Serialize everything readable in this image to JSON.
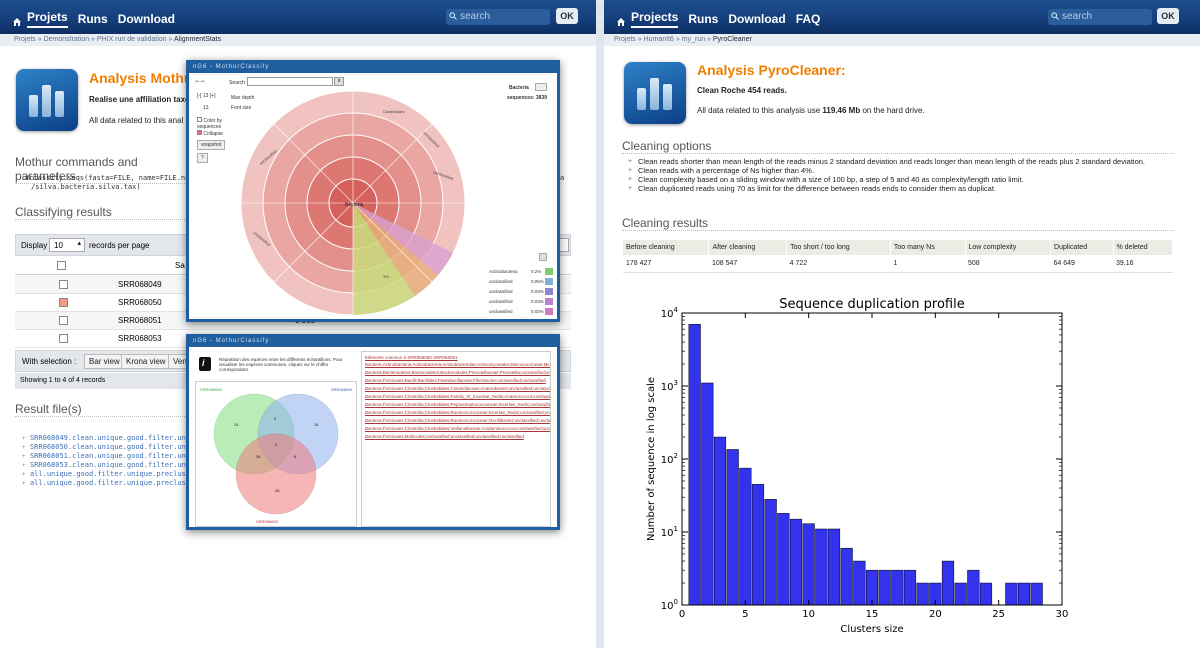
{
  "left": {
    "nav": {
      "projects": "Projets",
      "runs": "Runs",
      "download": "Download"
    },
    "search_placeholder": "search",
    "ok": "OK",
    "breadcrumb": [
      "Projets",
      "Demonstration",
      "PHIX run de validation",
      "AlignmentStats"
    ],
    "title": "Analysis MothurC",
    "subtitle": "Realise une affiliation taxo",
    "disk_text": "All data related to this anal",
    "commands_title": "Mothur commands and parameters",
    "command_line1": "#classify.seqs(fasta=FILE, name=FILE.names,",
    "command_line1_tail": "a",
    "command_line2": "/silva.bacteria.silva.tax)",
    "classifying_title": "Classifying results",
    "display_label": "Display",
    "display_value": "10",
    "records_label": "records per page",
    "col_sample": "Sa",
    "rows": [
      "SRR068049",
      "SRR068050",
      "SRR068051",
      "SRR068053"
    ],
    "row_side_value": "3 508",
    "with_selection": "With selection :",
    "bar_view": "Bar view",
    "krona_view": "Krona view",
    "ven_btn": "Ven",
    "showing": "Showing 1 to 4 of 4 records",
    "result_files_title": "Result file(s)",
    "files": [
      "SRR068049.clean.unique.good.filter.unique",
      "SRR068050.clean.unique.good.filter.unique",
      "SRR068051.clean.unique.good.filter.unique",
      "SRR068053.clean.unique.good.filter.unique",
      "all.unique.good.filter.unique.precluster.pi",
      "all.unique.good.filter.unique.precluster.pl"
    ],
    "krona": {
      "title": "nG6 - MothurClassify",
      "search_label": "Search:",
      "max_depth": "Max depth",
      "font_size": "Font size",
      "depth_val": "13",
      "color_by": "Color by sequences",
      "collapse": "Collapse",
      "snapshot": "snapshot",
      "root": "Bacteria",
      "header_right": "Bacteria",
      "sequences": "sequences: 3839",
      "legend": [
        {
          "name": "Actinobacteria",
          "pct": "0.2%",
          "color": "#7ecb6f"
        },
        {
          "name": "unclassified",
          "pct": "0.05%",
          "color": "#7fb1d8"
        },
        {
          "name": "unclassified",
          "pct": "0.03%",
          "color": "#8e86d1"
        },
        {
          "name": "unclassified",
          "pct": "0.03%",
          "color": "#b783d1"
        },
        {
          "name": "unclassified",
          "pct": "0.03%",
          "color": "#d07bc0"
        }
      ]
    },
    "venn": {
      "title": "nG6 - MothurClassify",
      "desc": "Répartition des espèces entre les différents échantillons. Pour visualiser les espèces communes, cliquez sur le chiffre correspondant.",
      "label_a": "SRR068050",
      "label_b": "SRR068051",
      "label_c": "SRR068053",
      "values": [
        "24",
        "5",
        "18",
        "3",
        "36",
        "8",
        "28"
      ],
      "list_header": "Éléments commun à SRR068050 SRR068051",
      "list": [
        "Bacteria;Actinobacteria;Actinobacteria;Actinobacteridae;Actinomycetales;Micrococcineae;Micrococcaceae;Rothia;unclassified",
        "Bacteria;Bacteroidetes;Bacteroidetes;Bacteroidales;Prevotellaceae;Prevotella;unclassified;unclassified",
        "Bacteria;Firmicutes;Bacilli;Bacillales;Paenibacillaceae;Fibrobacter;unclassified;unclassified",
        "Bacteria;Firmicutes;Clostridia;Clostridiales;Clostridiaceae;Anaerobacter;unclassified;unclassified",
        "Bacteria;Firmicutes;Clostridia;Clostridiales;Family_XI_Incertae_Sedis;Anaerococcus;unclassified",
        "Bacteria;Firmicutes;Clostridia;Clostridiales;Peptostreptococcaceae;Incertae_Sedis;unclassified",
        "Bacteria;Firmicutes;Clostridia;Clostridiales;Ruminococcaceae;Incertae_Sedis;unclassified;unclassified",
        "Bacteria;Firmicutes;Clostridia;Clostridiales;Ruminococcaceae;Oscillibacter;unclassified;unclassified",
        "Bacteria;Firmicutes;Clostridia;Clostridiales;Veillonellaceae;Acidaminococcus;unclassified;unclassified",
        "Bacteria;Firmicutes;Mollicutes;unclassified;unclassified;unclassified;unclassified"
      ]
    }
  },
  "right": {
    "nav": {
      "projects": "Projects",
      "runs": "Runs",
      "download": "Download",
      "faq": "FAQ"
    },
    "search_placeholder": "search",
    "ok": "OK",
    "breadcrumb": [
      "Projets",
      "HumanIt6",
      "my_run",
      "PyroCleaner"
    ],
    "title": "Analysis PyroCleaner:",
    "subtitle": "Clean Roche 454 reads.",
    "disk_prefix": "All data related to this analysis use ",
    "disk_value": "119.46 Mb",
    "disk_suffix": " on the hard drive.",
    "options_title": "Cleaning options",
    "options": [
      "Clean reads shorter than mean length of the reads minus 2 standard deviation and reads longer than mean length of the reads plus 2 standard deviation.",
      "Clean reads with a percentage of Ns higher than 4%.",
      "Clean complexity based on a sliding window with a size of 100 bp, a step of 5 and 40 as complexity/length ratio limit.",
      "Clean duplicated reads using 70 as limit for the difference between reads ends to consider them as duplicat."
    ],
    "results_title": "Cleaning results",
    "table_headers": [
      "Before cleaning",
      "After cleaning",
      "Too short / too long",
      "Too many Ns",
      "Low complexity",
      "Duplicated",
      "% deleted"
    ],
    "table_row": [
      "178 427",
      "108 547",
      "4 722",
      "1",
      "508",
      "64 649",
      "39.16"
    ]
  },
  "chart_data": {
    "type": "bar",
    "title": "Sequence duplication profile",
    "xlabel": "Clusters size",
    "ylabel": "Number of sequence in log scale",
    "xlim": [
      0,
      30
    ],
    "ylim": [
      1,
      10000
    ],
    "yscale": "log",
    "xticks": [
      "0",
      "5",
      "10",
      "15",
      "20",
      "25",
      "30"
    ],
    "yticks": [
      "10^0",
      "10^1",
      "10^2",
      "10^3",
      "10^4"
    ],
    "color": "#3333ee",
    "x": [
      1,
      2,
      3,
      4,
      5,
      6,
      7,
      8,
      9,
      10,
      11,
      12,
      13,
      14,
      15,
      16,
      17,
      18,
      19,
      20,
      21,
      22,
      23,
      24,
      25,
      26,
      27,
      28,
      29,
      30
    ],
    "values": [
      7000,
      1100,
      200,
      135,
      75,
      45,
      28,
      18,
      15,
      13,
      11,
      11,
      6,
      4,
      3,
      3,
      3,
      3,
      2,
      2,
      4,
      2,
      3,
      2,
      1,
      2,
      2,
      2,
      1,
      1
    ]
  }
}
